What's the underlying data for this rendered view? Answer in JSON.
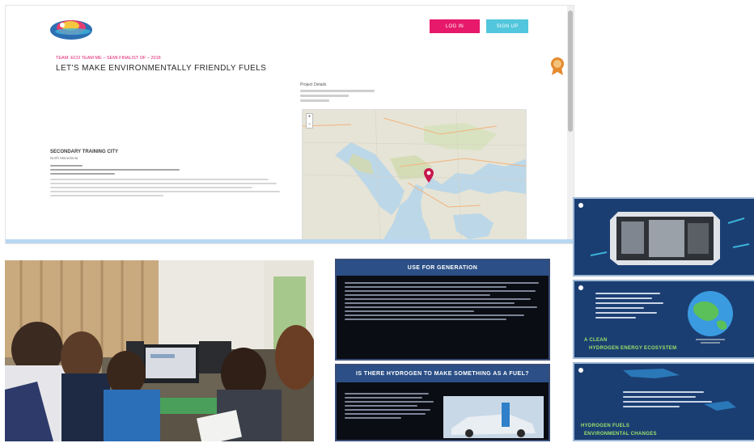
{
  "website": {
    "header": {
      "login_button": "LOG IN",
      "register_button": "SIGN UP"
    },
    "hero": {
      "kicker": "TEAM: ECO TEAM ME – SEMI-FINALIST OF – 2018",
      "title": "LET'S MAKE ENVIRONMENTALLY FRIENDLY FUELS"
    },
    "project_info": {
      "address_label": "Project Details"
    },
    "school": {
      "name": "SECONDARY TRAINING CITY",
      "subtitle": "North Macedonia"
    }
  },
  "slides": {
    "slide_a_title": "USE FOR GENERATION",
    "slide_b_title": "IS THERE HYDROGEN TO MAKE SOMETHING AS A FUEL?",
    "deck2_caption_1": "A CLEAN",
    "deck2_caption_2": "HYDROGEN ENERGY ECOSYSTEM",
    "deck3_caption_1": "HYDROGEN FUELS",
    "deck3_caption_2": "ENVIRONMENTAL CHANGES"
  },
  "colors": {
    "accent_pink": "#e6196b",
    "accent_cyan": "#52c6dc",
    "slide_header_blue": "#2b4f86",
    "deck_blue": "#1b3e72",
    "deck_green_text": "#9be26a"
  },
  "icons": {
    "map_pin": "map-pin-icon",
    "badge": "award-badge-icon",
    "logo": "site-logo"
  }
}
